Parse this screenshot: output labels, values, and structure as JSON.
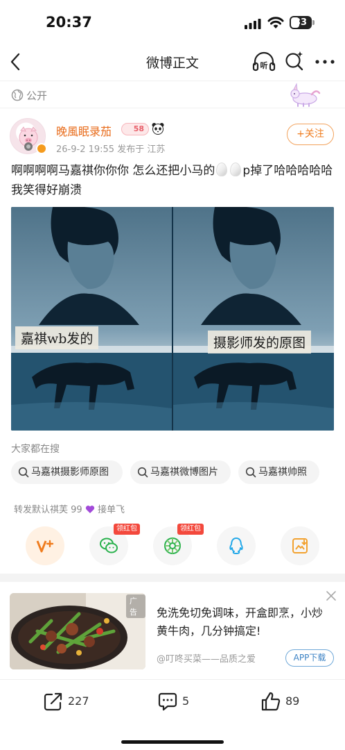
{
  "status_bar": {
    "time": "20:37",
    "battery": "33"
  },
  "nav": {
    "title": "微博正文",
    "listen_label": "听"
  },
  "visibility": {
    "label": "公开"
  },
  "author": {
    "name": "晚風眠录茄",
    "level": "58",
    "meta": "26-9-2 19:55  发布于 江苏",
    "follow_label": "+关注"
  },
  "post": {
    "text_before": "啊啊啊啊马嘉祺你你你 怎么还把小马的",
    "text_after": "p掉了哈哈哈哈哈我笑得好崩溃",
    "image": {
      "caption_left": "嘉祺wb发的",
      "caption_right": "摄影师发的原图"
    }
  },
  "search": {
    "heading": "大家都在搜",
    "chips": [
      "马嘉祺摄影师原图",
      "马嘉祺微博图片",
      "马嘉祺帅照"
    ]
  },
  "forward_note": {
    "before": "转发默认祺芙 99",
    "after": "接单飞"
  },
  "share": {
    "redpack_label": "领红包"
  },
  "ad": {
    "tag": "广告",
    "text": "免洗免切免调味，开盒即烹，小炒黄牛肉，几分钟搞定!",
    "source": "@叮咚买菜——品质之爱",
    "download_label": "APP下载"
  },
  "actions": {
    "forward_count": "227",
    "comment_count": "5",
    "like_count": "89"
  },
  "colors": {
    "accent": "#ef7c1e",
    "link": "#3b82c4",
    "redpack": "#f3483c"
  }
}
